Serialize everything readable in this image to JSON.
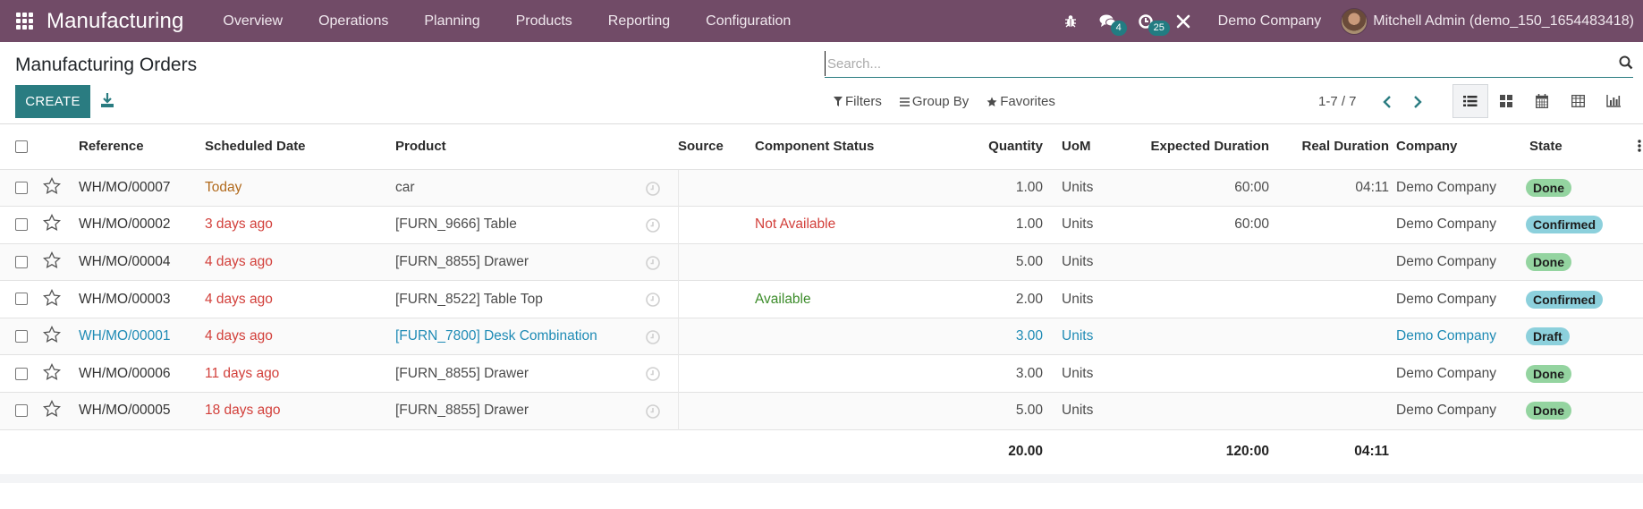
{
  "navbar": {
    "app_name": "Manufacturing",
    "menu": [
      "Overview",
      "Operations",
      "Planning",
      "Products",
      "Reporting",
      "Configuration"
    ],
    "messages_count": "4",
    "activities_count": "25",
    "company": "Demo Company",
    "user": "Mitchell Admin (demo_150_1654483418)"
  },
  "control": {
    "title": "Manufacturing Orders",
    "create_label": "CREATE",
    "search_placeholder": "Search...",
    "filters_label": "Filters",
    "groupby_label": "Group By",
    "favorites_label": "Favorites",
    "pager": "1-7 / 7"
  },
  "columns": [
    "Reference",
    "Scheduled Date",
    "Product",
    "Source",
    "Component Status",
    "Quantity",
    "UoM",
    "Expected Duration",
    "Real Duration",
    "Company",
    "State"
  ],
  "rows": [
    {
      "reference": "WH/MO/00007",
      "date": "Today",
      "date_tone": "orange",
      "product": "car",
      "source": "",
      "component_status": "",
      "component_tone": "",
      "quantity": "1.00",
      "uom": "Units",
      "expected": "60:00",
      "real": "04:11",
      "company": "Demo Company",
      "state": "Done",
      "state_kind": "done",
      "highlight": false
    },
    {
      "reference": "WH/MO/00002",
      "date": "3 days ago",
      "date_tone": "red",
      "product": "[FURN_9666] Table",
      "source": "",
      "component_status": "Not Available",
      "component_tone": "red",
      "quantity": "1.00",
      "uom": "Units",
      "expected": "60:00",
      "real": "",
      "company": "Demo Company",
      "state": "Confirmed",
      "state_kind": "confirmed",
      "highlight": false
    },
    {
      "reference": "WH/MO/00004",
      "date": "4 days ago",
      "date_tone": "red",
      "product": "[FURN_8855] Drawer",
      "source": "",
      "component_status": "",
      "component_tone": "",
      "quantity": "5.00",
      "uom": "Units",
      "expected": "",
      "real": "",
      "company": "Demo Company",
      "state": "Done",
      "state_kind": "done",
      "highlight": false
    },
    {
      "reference": "WH/MO/00003",
      "date": "4 days ago",
      "date_tone": "red",
      "product": "[FURN_8522] Table Top",
      "source": "",
      "component_status": "Available",
      "component_tone": "green",
      "quantity": "2.00",
      "uom": "Units",
      "expected": "",
      "real": "",
      "company": "Demo Company",
      "state": "Confirmed",
      "state_kind": "confirmed",
      "highlight": false
    },
    {
      "reference": "WH/MO/00001",
      "date": "4 days ago",
      "date_tone": "red",
      "product": "[FURN_7800] Desk Combination",
      "source": "",
      "component_status": "",
      "component_tone": "",
      "quantity": "3.00",
      "uom": "Units",
      "expected": "",
      "real": "",
      "company": "Demo Company",
      "state": "Draft",
      "state_kind": "draft",
      "highlight": true
    },
    {
      "reference": "WH/MO/00006",
      "date": "11 days ago",
      "date_tone": "red",
      "product": "[FURN_8855] Drawer",
      "source": "",
      "component_status": "",
      "component_tone": "",
      "quantity": "3.00",
      "uom": "Units",
      "expected": "",
      "real": "",
      "company": "Demo Company",
      "state": "Done",
      "state_kind": "done",
      "highlight": false
    },
    {
      "reference": "WH/MO/00005",
      "date": "18 days ago",
      "date_tone": "red",
      "product": "[FURN_8855] Drawer",
      "source": "",
      "component_status": "",
      "component_tone": "",
      "quantity": "5.00",
      "uom": "Units",
      "expected": "",
      "real": "",
      "company": "Demo Company",
      "state": "Done",
      "state_kind": "done",
      "highlight": false
    }
  ],
  "totals": {
    "quantity": "20.00",
    "expected": "120:00",
    "real": "04:11"
  },
  "colors": {
    "navbar": "#714b67",
    "primary": "#2a7c81",
    "done": "#94d4a0",
    "confirmed": "#8cd0dc",
    "late": "#d23f3a",
    "today": "#b16a1c",
    "available": "#3c8c2a",
    "draft_text": "#1f8bb5"
  }
}
